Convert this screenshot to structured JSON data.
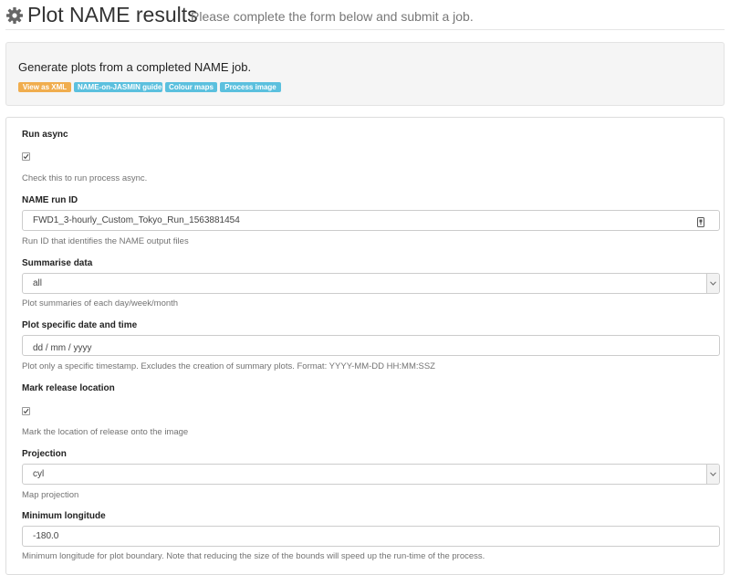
{
  "header": {
    "gear_icon": "gear-icon",
    "title": "Plot NAME results",
    "subtitle": "Please complete the form below and submit a job."
  },
  "intro": {
    "text": "Generate plots from a completed NAME job.",
    "labels": [
      {
        "text": "View as XML",
        "color": "#f0ad4e"
      },
      {
        "text": "NAME-on-JASMIN guide",
        "color": "#5bc0de"
      },
      {
        "text": "Colour maps",
        "color": "#5bc0de"
      },
      {
        "text": "Process image",
        "color": "#5bc0de"
      }
    ]
  },
  "form": {
    "run_async": {
      "label": "Run async",
      "checked": true,
      "help": "Check this to run process async."
    },
    "run_id": {
      "label": "NAME run ID",
      "value": "FWD1_3-hourly_Custom_Tokyo_Run_1563881454",
      "icon": "keychain-icon",
      "help": "Run ID that identifies the NAME output files"
    },
    "summarise": {
      "label": "Summarise data",
      "value": "all",
      "help": "Plot summaries of each day/week/month"
    },
    "specific_date": {
      "label": "Plot specific date and time",
      "placeholder": "dd / mm / yyyy",
      "help": "Plot only a specific timestamp. Excludes the creation of summary plots. Format: YYYY-MM-DD HH:MM:SSZ"
    },
    "mark_release": {
      "label": "Mark release location",
      "checked": true,
      "help": "Mark the location of release onto the image"
    },
    "projection": {
      "label": "Projection",
      "value": "cyl",
      "help": "Map projection"
    },
    "min_lon": {
      "label": "Minimum longitude",
      "value": "-180.0",
      "help": "Minimum longitude for plot boundary. Note that reducing the size of the bounds will speed up the run-time of the process."
    }
  }
}
